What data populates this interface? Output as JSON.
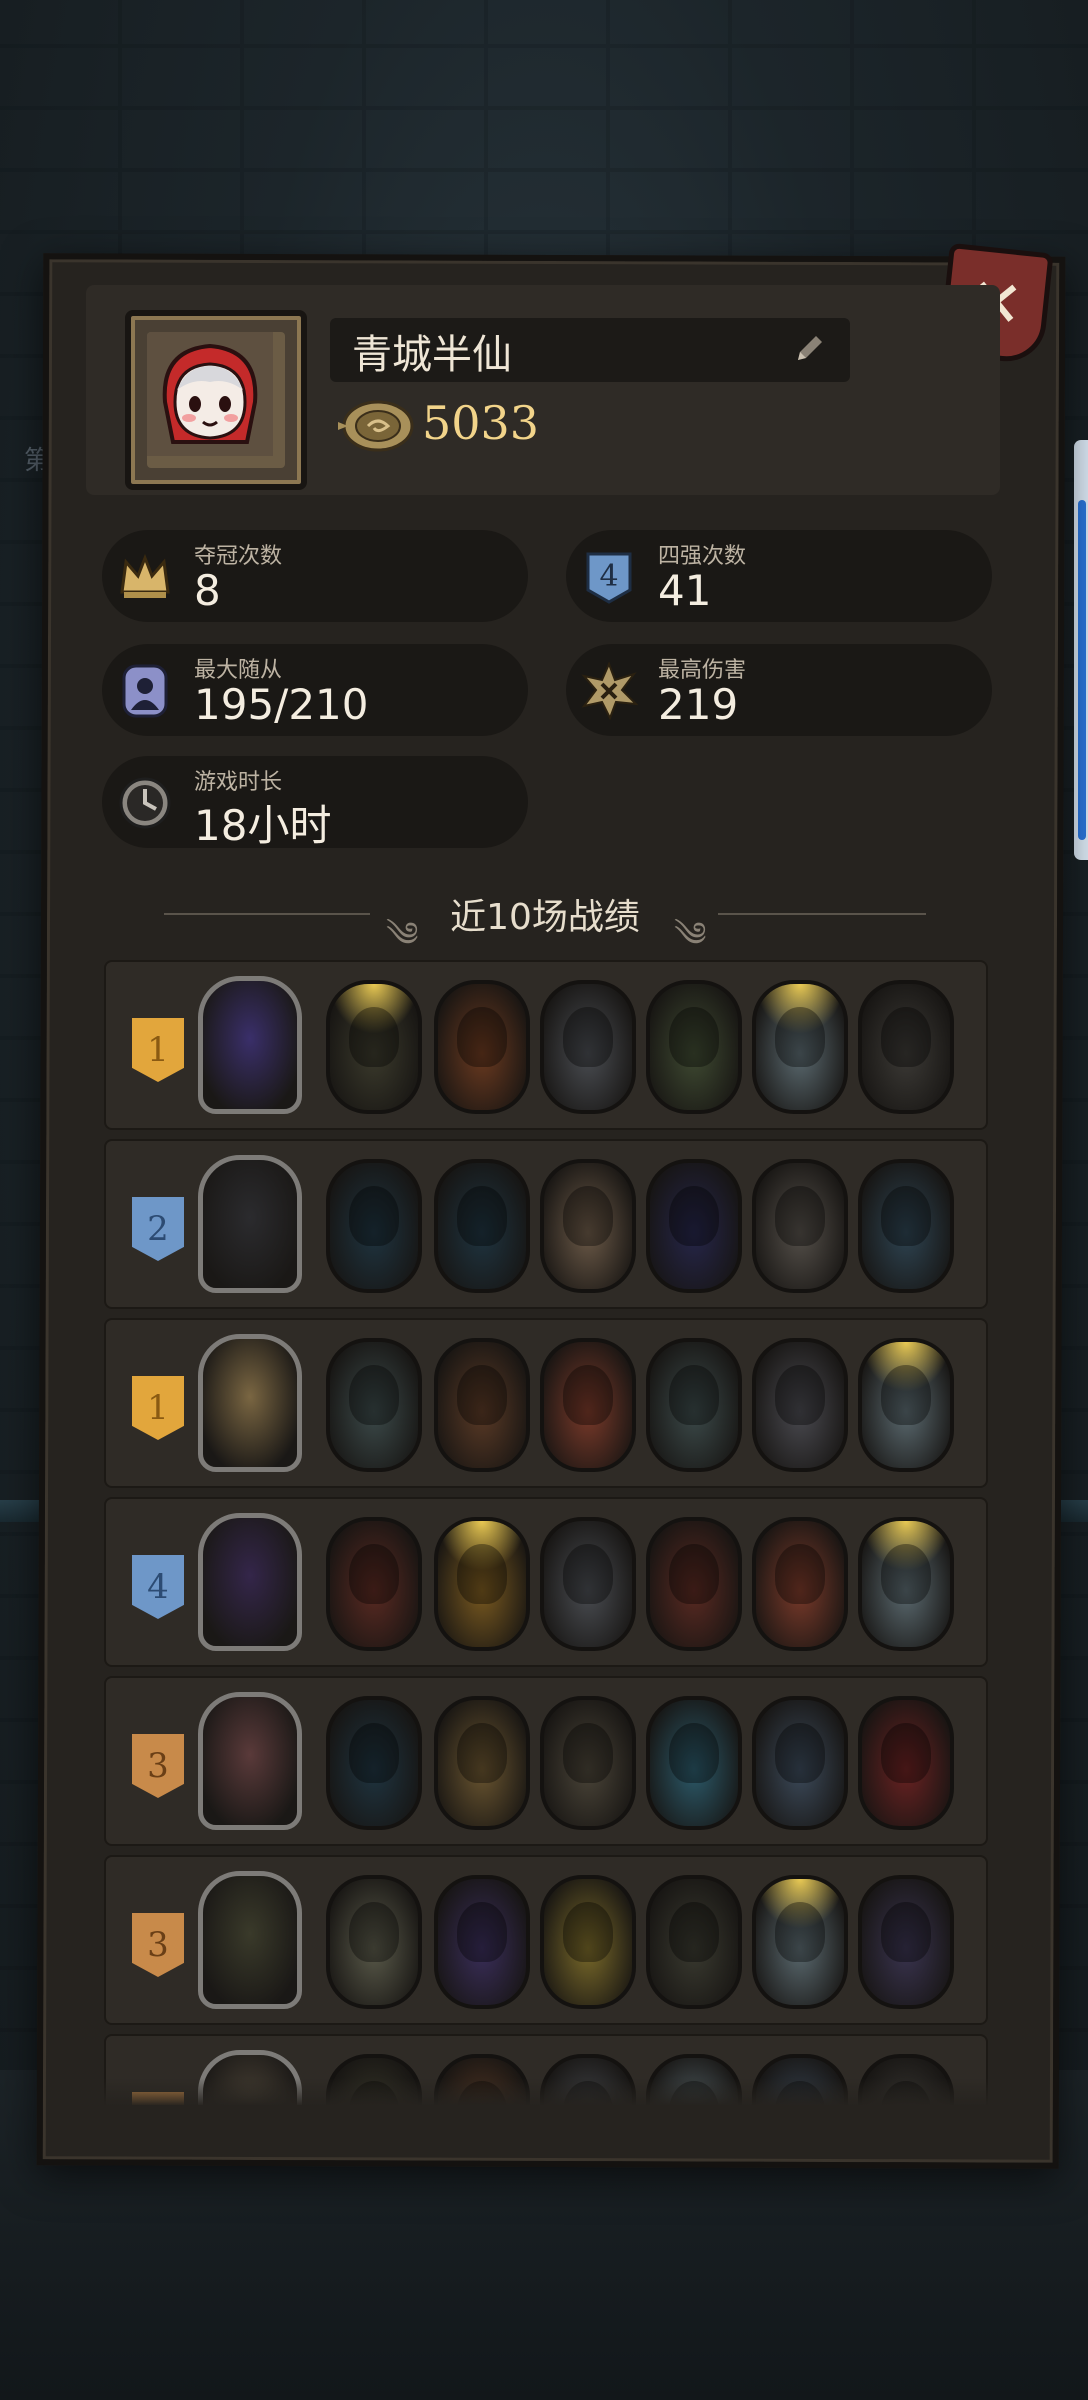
{
  "background": {
    "side_text": "第"
  },
  "profile": {
    "name": "青城半仙",
    "coins": "5033",
    "avatar_icon": "girl-red-hood-avatar"
  },
  "close_icon": "close-x-icon",
  "stats": [
    {
      "id": "championships",
      "label": "夺冠次数",
      "value": "8",
      "icon": "crown-icon"
    },
    {
      "id": "top4",
      "label": "四强次数",
      "value": "41",
      "icon": "shield-4-icon"
    },
    {
      "id": "max_minions",
      "label": "最大随从",
      "value": "195/210",
      "icon": "portrait-icon"
    },
    {
      "id": "max_damage",
      "label": "最高伤害",
      "value": "219",
      "icon": "burst-icon"
    },
    {
      "id": "play_time",
      "label": "游戏时长",
      "value": "18小时",
      "icon": "clock-icon"
    }
  ],
  "recent": {
    "title": "近10场战绩",
    "matches": [
      {
        "rank": "1",
        "tier": "gold",
        "hero_color": "#3a2f6a",
        "units": [
          "#3b3a2c",
          "#6b3a20",
          "#4a4d52",
          "#3f4a32",
          "#5b6a70",
          "#3c3a36"
        ]
      },
      {
        "rank": "2",
        "tier": "blue",
        "hero_color": "#2b2b2e",
        "units": [
          "#1f3440",
          "#1f3440",
          "#6c5a48",
          "#26264a",
          "#55504a",
          "#2e4452"
        ]
      },
      {
        "rank": "1",
        "tier": "gold",
        "hero_color": "#7a6642",
        "units": [
          "#3c4a4a",
          "#5a3a26",
          "#7a3a2a",
          "#3c4a4a",
          "#4a4a50",
          "#5b6a70"
        ]
      },
      {
        "rank": "4",
        "tier": "blue",
        "hero_color": "#34264a",
        "units": [
          "#5a2a22",
          "#7a5a20",
          "#4a4d52",
          "#5a2a22",
          "#7a3a2a",
          "#5b6a70"
        ]
      },
      {
        "rank": "3",
        "tier": "bronze",
        "hero_color": "#5a3a3a",
        "units": [
          "#1f3440",
          "#6a5530",
          "#4a4438",
          "#2c5a6a",
          "#3c4a5a",
          "#6a2222"
        ]
      },
      {
        "rank": "3",
        "tier": "bronze",
        "hero_color": "#3a3a2a",
        "units": [
          "#5a5a4a",
          "#3a2e5a",
          "#7a6a2a",
          "#3a3a30",
          "#5b6a70",
          "#3a3450"
        ]
      },
      {
        "rank": "",
        "tier": "bronze",
        "hero_color": "#4a4236",
        "units": [
          "#3b3a2c",
          "#5a3a26",
          "#4a4d52",
          "#5b6a70",
          "#3c4a5a",
          "#3c3a36"
        ]
      }
    ]
  }
}
